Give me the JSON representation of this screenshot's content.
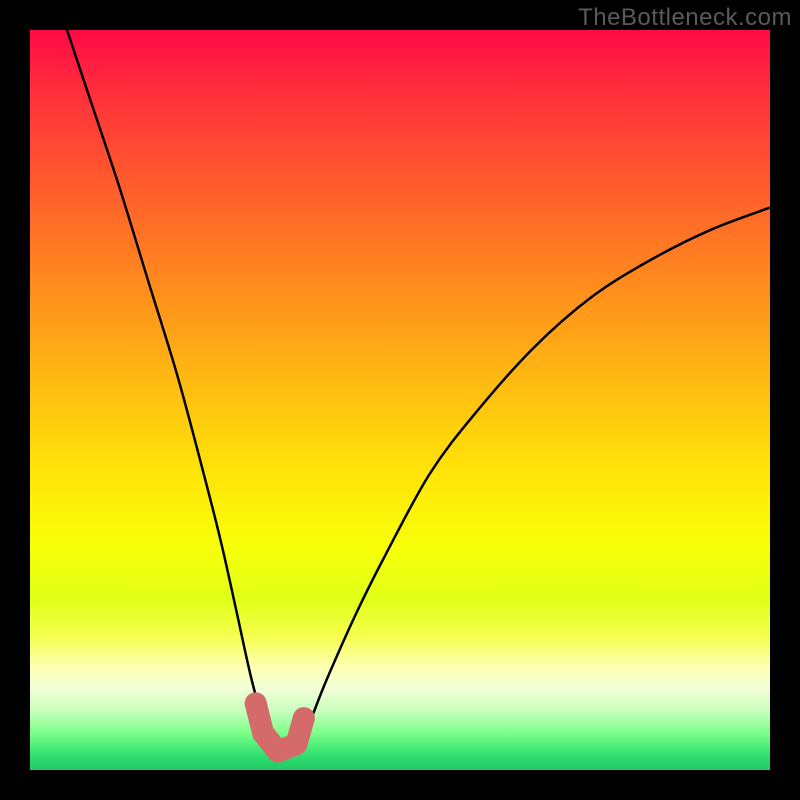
{
  "watermark": "TheBottleneck.com",
  "colors": {
    "frame": "#000000",
    "curve_stroke": "#000000",
    "marker_fill": "#d46a6a",
    "gradient_top": "#ff0a46",
    "gradient_bottom": "#22c865"
  },
  "chart_data": {
    "type": "line",
    "title": "",
    "xlabel": "",
    "ylabel": "",
    "xlim": [
      0,
      100
    ],
    "ylim": [
      0,
      100
    ],
    "x": [
      5,
      8,
      12,
      16,
      20,
      24,
      26,
      28,
      30,
      32,
      33,
      34,
      35,
      36,
      38,
      40,
      44,
      48,
      54,
      60,
      68,
      76,
      84,
      92,
      100
    ],
    "y": [
      100,
      91,
      79,
      66,
      53,
      38,
      30,
      21,
      12,
      5,
      3,
      2,
      2,
      3,
      7,
      12,
      21,
      29,
      40,
      48,
      57,
      64,
      69,
      73,
      76
    ],
    "markers": [
      {
        "x": 30.5,
        "y": 9
      },
      {
        "x": 31.5,
        "y": 5
      },
      {
        "x": 33.5,
        "y": 2.5
      },
      {
        "x": 36.0,
        "y": 3.5
      },
      {
        "x": 37.0,
        "y": 7
      }
    ],
    "note": "y-axis inverted visually: 0 at bottom, 100 at top; values represent bottleneck percentage"
  }
}
